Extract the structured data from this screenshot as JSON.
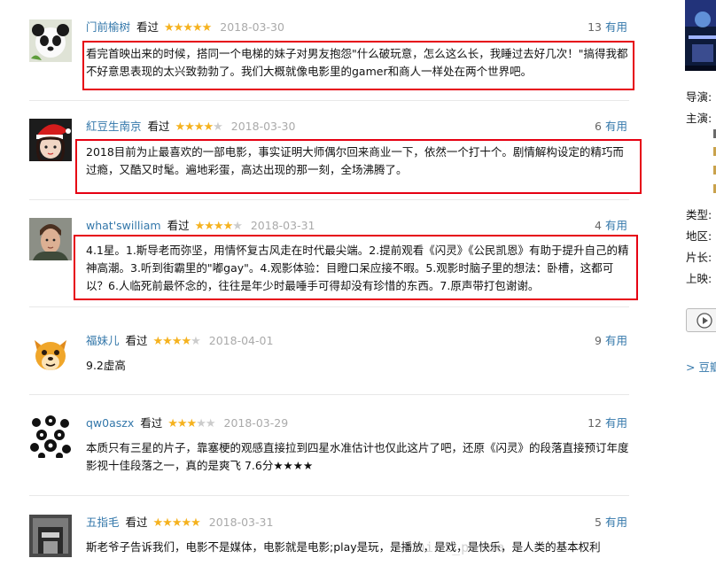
{
  "comments": [
    {
      "author": "门前榆树",
      "status": "看过",
      "rating": 5,
      "date": "2018-03-30",
      "votes": "13",
      "useful_label": "有用",
      "text": "看完首映出来的时候，搭同一个电梯的妹子对男友抱怨\"什么破玩意，怎么这么长，我睡过去好几次！\"搞得我都不好意思表现的太兴致勃勃了。我们大概就像电影里的gamer和商人一样处在两个世界吧。",
      "highlighted": true
    },
    {
      "author": "紅豆生南京",
      "status": "看过",
      "rating": 4,
      "date": "2018-03-30",
      "votes": "6",
      "useful_label": "有用",
      "text": "2018目前为止最喜欢的一部电影，事实证明大师偶尔回来商业一下，依然一个打十个。剧情解构设定的精巧而过瘾，又酷又时髦。遍地彩蛋，高达出现的那一刻，全场沸腾了。",
      "highlighted": true
    },
    {
      "author": "what'swilliam",
      "status": "看过",
      "rating": 4,
      "date": "2018-03-31",
      "votes": "4",
      "useful_label": "有用",
      "text": "4.1星。1.斯导老而弥坚，用情怀复古风走在时代最尖端。2.提前观看《闪灵》《公民凯恩》有助于提升自己的精神高潮。3.听到街霸里的\"嘟gay\"。4.观影体验：目瞪口呆应接不暇。5.观影时脑子里的想法：卧槽，这都可以？6.人临死前最怀念的，往往是年少时最唾手可得却没有珍惜的东西。7.原声带打包谢谢。",
      "highlighted": true
    },
    {
      "author": "福妹儿",
      "status": "看过",
      "rating": 4,
      "date": "2018-04-01",
      "votes": "9",
      "useful_label": "有用",
      "text": "9.2虚高",
      "highlighted": false
    },
    {
      "author": "qw0aszx",
      "status": "看过",
      "rating": 3,
      "date": "2018-03-29",
      "votes": "12",
      "useful_label": "有用",
      "text": "本质只有三星的片子，靠塞梗的观感直接拉到四星水准估计也仅此这片了吧，还原《闪灵》的段落直接预订年度影视十佳段落之一，真的是爽飞 7.6分★★★★",
      "highlighted": false
    },
    {
      "author": "五指毛",
      "status": "看过",
      "rating": 5,
      "date": "2018-03-31",
      "votes": "5",
      "useful_label": "有用",
      "text": "斯老爷子告诉我们，电影不是媒体，电影就是电影;play是玩，是播放，是戏，是快乐，是人类的基本权利",
      "highlighted": false
    }
  ],
  "sidebar": {
    "director_label": "导演:",
    "cast_label": "主演:",
    "genre_label": "类型:",
    "region_label": "地区:",
    "runtime_label": "片长:",
    "release_label": "上映:",
    "link_text": "> 豆瓣"
  },
  "watermark": "mini_panda",
  "colors": {
    "link": "#3377aa",
    "star": "#f5b21f",
    "highlight_box": "#e60012"
  }
}
